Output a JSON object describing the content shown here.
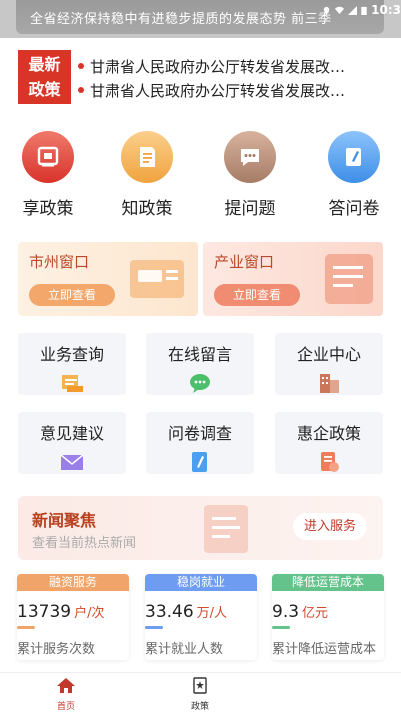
{
  "banner": {
    "text": "全省经济保持稳中有进稳步提质的发展态势 前三季",
    "time": "10:3"
  },
  "policy": {
    "badge_line1": "最新",
    "badge_line2": "政策",
    "items": [
      "甘肃省人民政府办公厅转发省发展改…",
      "甘肃省人民政府办公厅转发省发展改…"
    ]
  },
  "round_nav": [
    {
      "label": "享政策",
      "icon": "badge-icon"
    },
    {
      "label": "知政策",
      "icon": "document-icon"
    },
    {
      "label": "提问题",
      "icon": "chat-icon"
    },
    {
      "label": "答问卷",
      "icon": "pen-icon"
    }
  ],
  "windows": [
    {
      "title": "市州窗口",
      "button": "立即查看"
    },
    {
      "title": "产业窗口",
      "button": "立即查看"
    }
  ],
  "grid": [
    {
      "label": "业务查询",
      "icon": "inbox-icon"
    },
    {
      "label": "在线留言",
      "icon": "message-icon"
    },
    {
      "label": "企业中心",
      "icon": "building-icon"
    },
    {
      "label": "意见建议",
      "icon": "envelope-icon"
    },
    {
      "label": "问卷调查",
      "icon": "survey-icon"
    },
    {
      "label": "惠企政策",
      "icon": "policy-icon"
    }
  ],
  "news": {
    "title": "新闻聚焦",
    "subtitle": "查看当前热点新闻",
    "button": "进入服务"
  },
  "stats": [
    {
      "header": "融资服务",
      "value": "13739",
      "unit": "户/次",
      "desc": "累计服务次数",
      "color": "#f0a46a"
    },
    {
      "header": "稳岗就业",
      "value": "33.46",
      "unit": "万/人",
      "desc": "累计就业人数",
      "color": "#6e9cf0"
    },
    {
      "header": "降低运营成本",
      "value": "9.3",
      "unit": "亿元",
      "desc": "累计降低运营成本",
      "color": "#64c28b"
    }
  ],
  "tabs": [
    {
      "label": "首页",
      "active": true
    },
    {
      "label": "政策",
      "active": false
    }
  ],
  "colors": {
    "primary": "#d93527",
    "tab_active": "#c0392b"
  }
}
